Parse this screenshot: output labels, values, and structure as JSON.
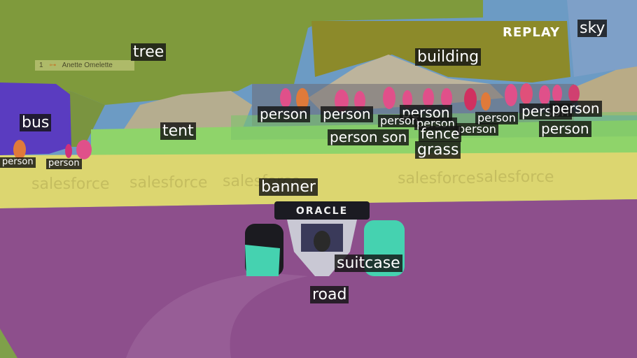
{
  "image": {
    "description_free": true,
    "overlay": {
      "replay_text": "REPLAY",
      "tower_position": "1",
      "tower_team_mark": "⊶",
      "tower_driver": "Anette Omelette"
    },
    "banner_text": "salesforce",
    "car_text": "ORACLE",
    "labels": {
      "sky": "sky",
      "tree": "tree",
      "building": "building",
      "bus": "bus",
      "tent": "tent",
      "grass": "grass",
      "fence": "fence",
      "banner": "banner",
      "suitcase": "suitcase",
      "road": "road",
      "person": "person",
      "person_partial": "son"
    },
    "colors": {
      "sky": "#6c9bc4",
      "tree": "#7f9a3c",
      "building": "#8c8a2a",
      "bus": "#5a3cc0",
      "tent": "#b5ad8f",
      "grass": "#8fd46a",
      "banner": "#dcd670",
      "road": "#8d4f8c",
      "suitcase": "#45d2b0",
      "person": "#e0508a"
    }
  }
}
